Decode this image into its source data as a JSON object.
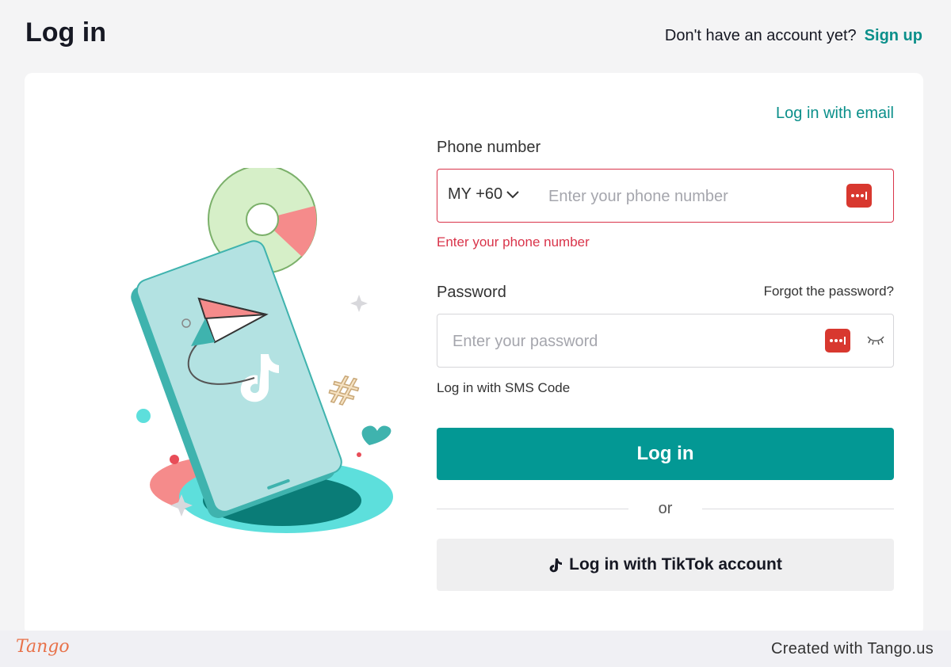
{
  "header": {
    "title": "Log in",
    "signup_prompt": "Don't have an account yet?",
    "signup_link": "Sign up"
  },
  "form": {
    "email_link": "Log in with email",
    "phone_label": "Phone number",
    "country_code": "MY +60",
    "phone_placeholder": "Enter your phone number",
    "phone_value": "",
    "phone_error": "Enter your phone number",
    "password_label": "Password",
    "forgot_link": "Forgot the password?",
    "password_placeholder": "Enter your password",
    "password_value": "",
    "sms_link": "Log in with SMS Code",
    "login_button": "Log in",
    "divider_text": "or",
    "tiktok_button": "Log in with TikTok account"
  },
  "colors": {
    "accent": "#039894",
    "link": "#0a8f8a",
    "error": "#d9344a",
    "password_manager": "#d8382f"
  },
  "icons": [
    "chevron-down-icon",
    "password-manager-icon",
    "eye-closed-icon",
    "tiktok-icon"
  ],
  "footer": {
    "logo": "Tango",
    "credit": "Created with Tango.us"
  }
}
